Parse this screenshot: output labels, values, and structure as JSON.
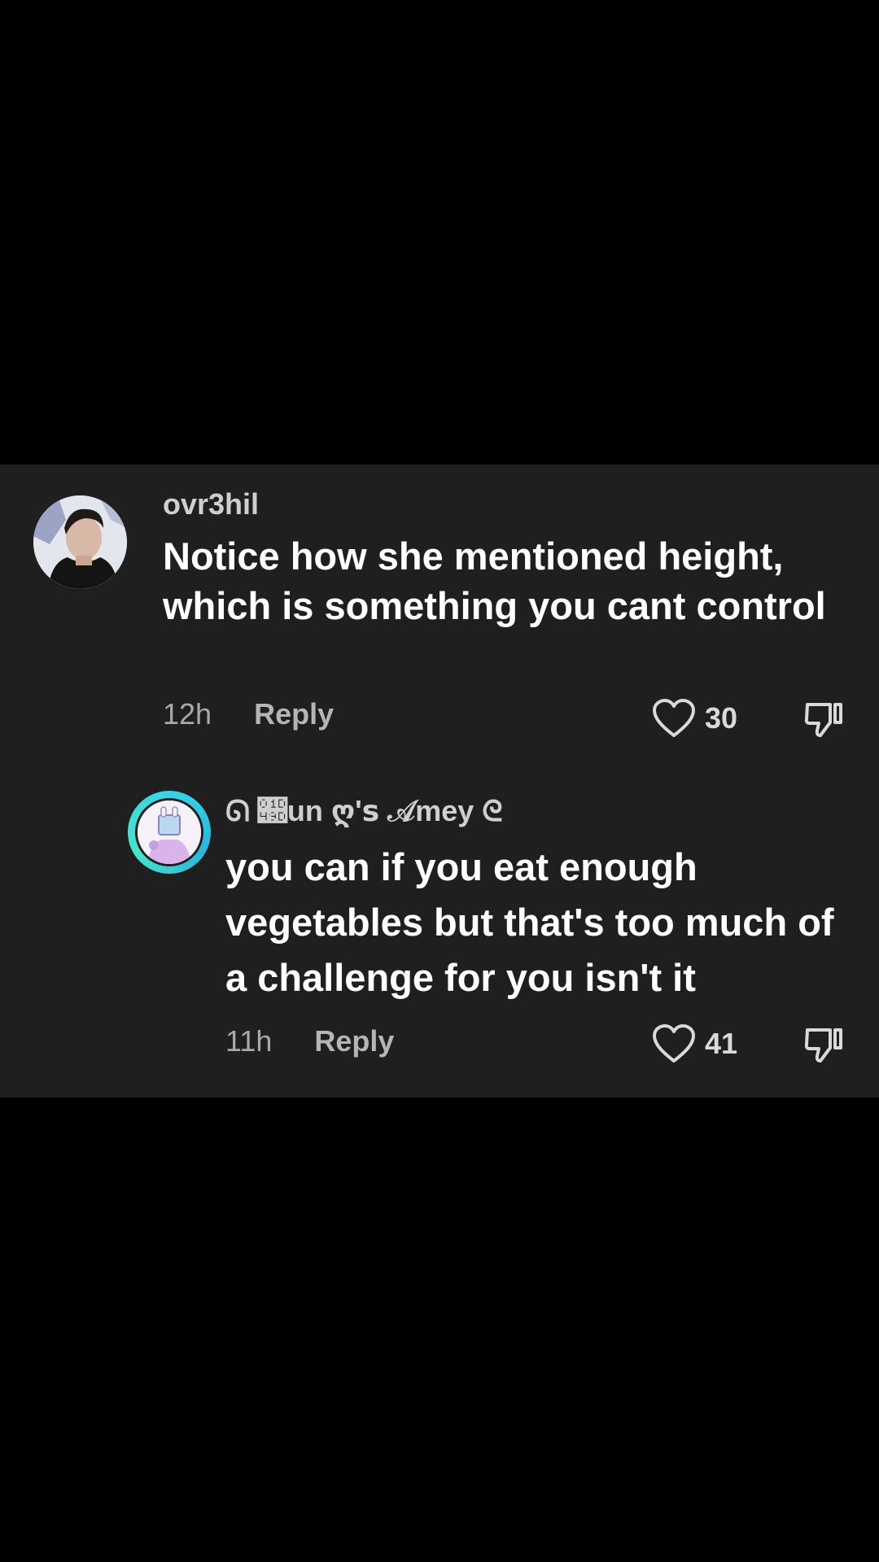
{
  "comments": [
    {
      "username": "ovr3hil",
      "text": "Notice how she mentioned height, which is something you cant control",
      "time": "12h",
      "reply_label": "Reply",
      "likes": "30",
      "avatar_icon": "profile-photo",
      "like_icon": "heart-outline-icon",
      "dislike_icon": "thumbs-down-icon"
    },
    {
      "username": "ᘏ 𝒝un ღ'ꜱ 𝒜mey ᘓ",
      "text": "you can if you eat enough vegetables but that's too much of a challenge for you isn't it",
      "time": "11h",
      "reply_label": "Reply",
      "likes": "41",
      "avatar_icon": "cartoon-avatar",
      "avatar_ring_color": "#38d4e6",
      "like_icon": "heart-outline-icon",
      "dislike_icon": "thumbs-down-icon"
    }
  ],
  "colors": {
    "background": "#000000",
    "panel": "#1f1f1f",
    "text_primary": "#ffffff",
    "text_secondary": "#a9a9a9"
  }
}
